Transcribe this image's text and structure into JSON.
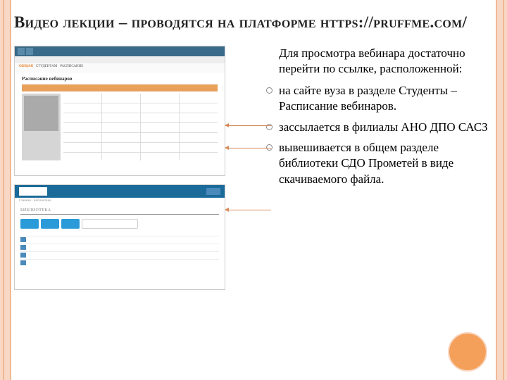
{
  "title": "Видео лекции – проводятся на платформе https://pruffme.com/",
  "intro": "Для просмотра вебинара достаточно перейти по ссылке, расположенной:",
  "bullets": [
    "на сайте вуза в разделе Студенты – Расписание вебинаров.",
    "зассылается в филиалы АНО ДПО САСЗ",
    "вывешивается в общем разделе библиотеки СДО Прометей в виде скачиваемого файла."
  ],
  "thumb1": {
    "tabs": [
      "ОБЩАЯ",
      "СТУДЕНТАМ",
      "РАСПИСАНИЕ"
    ],
    "heading": "Расписание вебинаров",
    "sublabel": "Расписание вебинаров"
  },
  "thumb2": {
    "crumb": "Главная / Библиотека",
    "label": "библиотека"
  }
}
